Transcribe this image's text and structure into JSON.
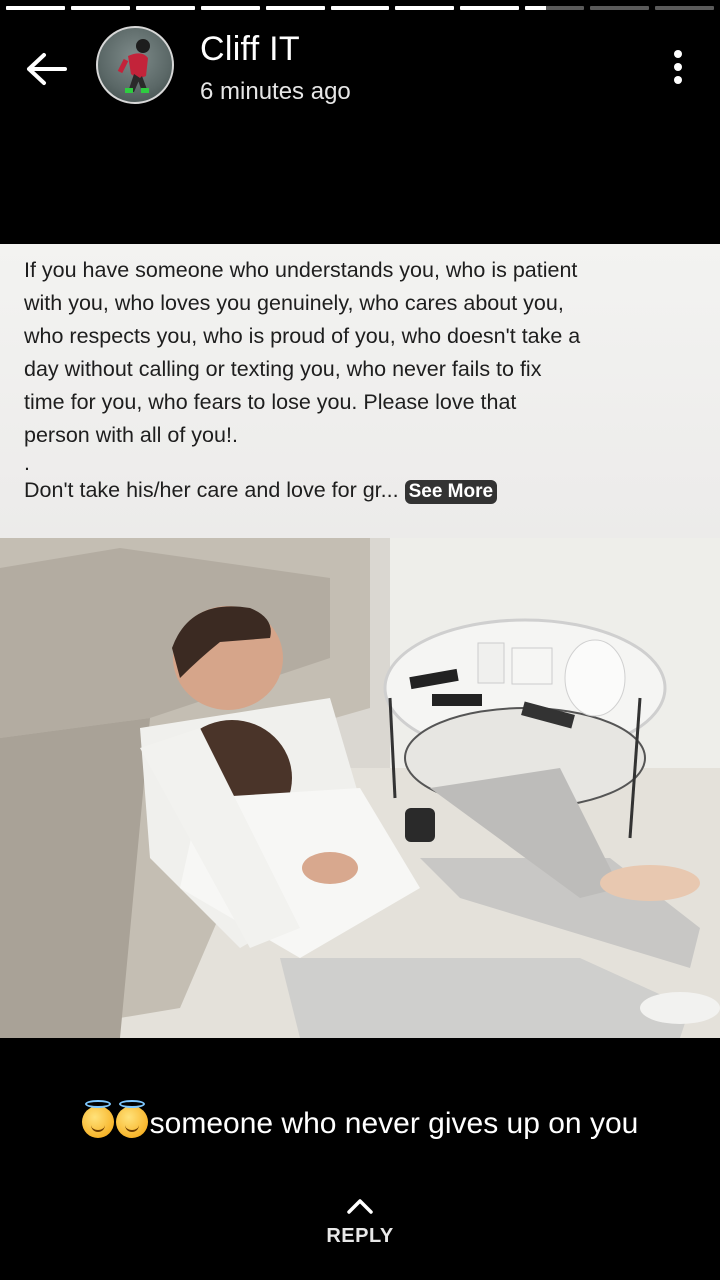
{
  "story": {
    "segments_total": 11,
    "active_segment": 8,
    "active_progress": 0.35
  },
  "header": {
    "back_icon": "arrow-left-icon",
    "user_name": "Cliff IT",
    "timestamp": "6 minutes ago",
    "menu_icon": "more-vertical-icon"
  },
  "post": {
    "lines": [
      "If you have someone who understands you, who is patient",
      "with you, who loves you genuinely, who cares about you,",
      "who respects you, who is proud of you, who doesn't take a",
      "day without calling or texting you, who never fails to fix",
      "time for you, who fears to lose you. Please love that",
      "person with all of you!."
    ],
    "dot": ".",
    "truncated_line": "Don't take his/her care and love for gr...",
    "see_more": "See More"
  },
  "status_caption": {
    "emoji": "smiling-face-with-halo-icon",
    "text": "someone who never gives up on you"
  },
  "reply": {
    "icon": "chevron-up-icon",
    "label": "REPLY"
  }
}
